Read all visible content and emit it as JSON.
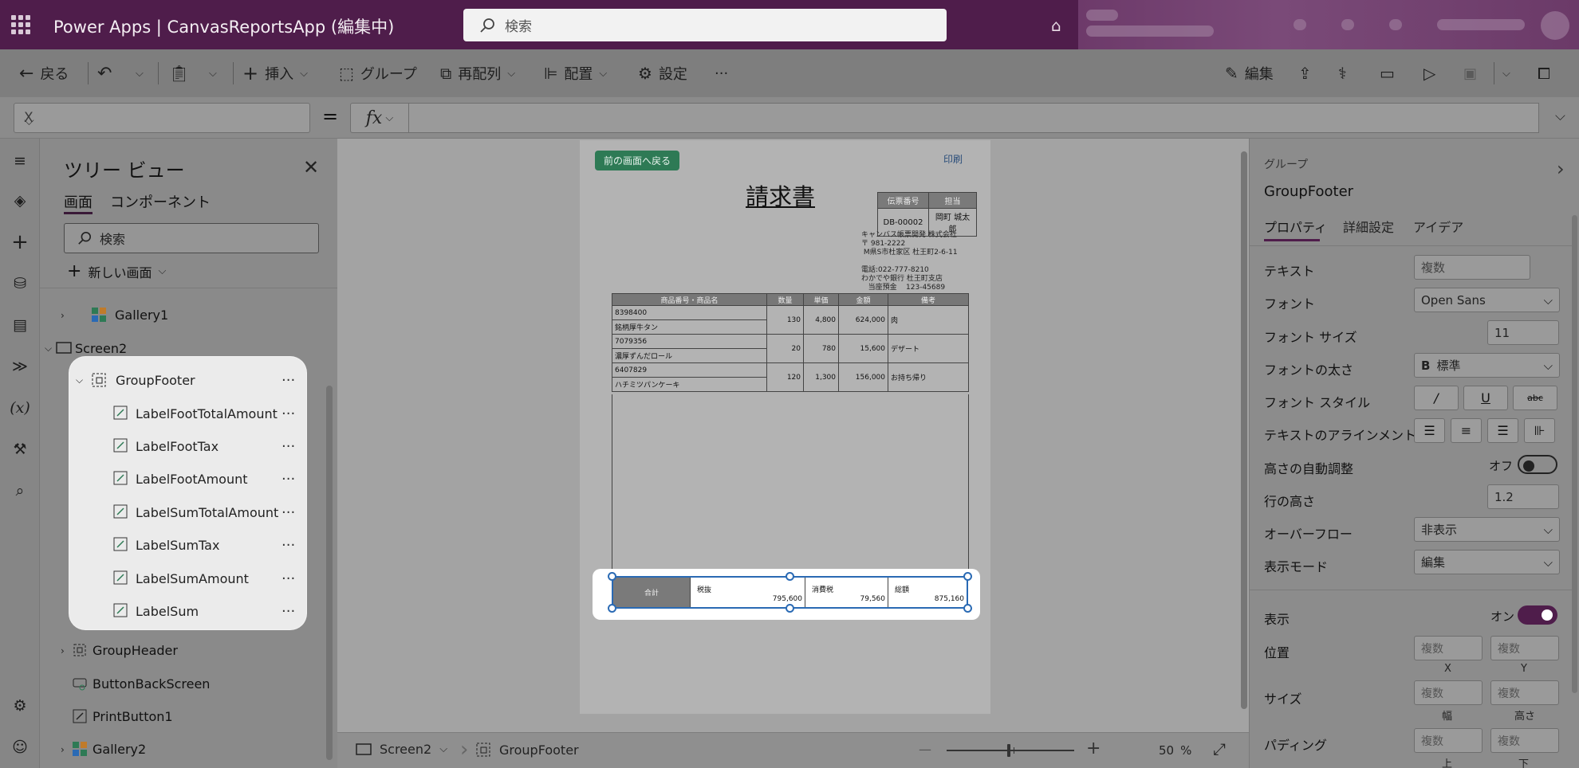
{
  "header": {
    "app_title": "Power Apps  |  CanvasReportsApp (編集中)",
    "search_placeholder": "検索"
  },
  "commandbar": {
    "back": "戻る",
    "insert": "挿入",
    "group": "グループ",
    "reorder": "再配列",
    "align": "配置",
    "settings": "設定",
    "more": "···",
    "edit": "編集"
  },
  "formulabar": {
    "property": "X",
    "equals": "=",
    "fx": "fx",
    "formula": ""
  },
  "tree": {
    "title": "ツリー ビュー",
    "tab_screens": "画面",
    "tab_components": "コンポーネント",
    "search_placeholder": "検索",
    "new_screen": "新しい画面",
    "items": [
      {
        "label": "Gallery1"
      },
      {
        "label": "Screen2"
      },
      {
        "label": "GroupFooter"
      },
      {
        "label": "LabelFootTotalAmount"
      },
      {
        "label": "LabelFootTax"
      },
      {
        "label": "LabelFootAmount"
      },
      {
        "label": "LabelSumTotalAmount"
      },
      {
        "label": "LabelSumTax"
      },
      {
        "label": "LabelSumAmount"
      },
      {
        "label": "LabelSum"
      },
      {
        "label": "GroupHeader"
      },
      {
        "label": "ButtonBackScreen"
      },
      {
        "label": "PrintButton1"
      },
      {
        "label": "Gallery2"
      }
    ],
    "dots": "···"
  },
  "canvas": {
    "back_button": "前の画面へ戻る",
    "print": "印刷",
    "title": "請求書",
    "slip": {
      "headers": [
        "伝票番号",
        "担当"
      ],
      "values": [
        "DB-00002",
        "岡町 城太郎"
      ]
    },
    "company": "キャンバス帳票開発 株式会社\n〒 981-2222\n M県S市杜家区 杜王町2-6-11\n\n電話:022-777-8210\nわかでや銀行 杜王町支店\n   当座預金    123-45689",
    "item_headers": [
      "商品番号・商品名",
      "数量",
      "単価",
      "金額",
      "備考"
    ],
    "items": [
      {
        "code": "8398400",
        "name": "銘柄厚牛タン",
        "qty": "130",
        "price": "4,800",
        "amount": "624,000",
        "note": "肉"
      },
      {
        "code": "7079356",
        "name": "濃厚ずんだロール",
        "qty": "20",
        "price": "780",
        "amount": "15,600",
        "note": "デザート"
      },
      {
        "code": "6407829",
        "name": "ハチミツパンケーキ",
        "qty": "120",
        "price": "1,300",
        "amount": "156,000",
        "note": "お持ち帰り"
      }
    ],
    "footer": {
      "sum_label": "合計",
      "tax_excl_label": "税抜",
      "tax_excl_value": "795,600",
      "tax_label": "消費税",
      "tax_value": "79,560",
      "total_label": "総額",
      "total_value": "875,160"
    }
  },
  "canvas_bar": {
    "screen": "Screen2",
    "group": "GroupFooter",
    "minus": "—",
    "plus": "+",
    "zoom": "50",
    "zoom_unit": "%"
  },
  "props": {
    "type": "グループ",
    "name": "GroupFooter",
    "tabs": [
      "プロパティ",
      "詳細設定",
      "アイデア"
    ],
    "text_label": "テキスト",
    "text_value": "複数",
    "font_label": "フォント",
    "font_value": "Open Sans",
    "font_size_label": "フォント サイズ",
    "font_size_value": "11",
    "font_weight_label": "フォントの太さ",
    "font_weight_value": "標準",
    "font_weight_glyph": "B",
    "font_style_label": "フォント スタイル",
    "italic": "/",
    "underline": "U",
    "strike": "abc",
    "text_align_label": "テキストのアラインメント",
    "auto_height_label": "高さの自動調整",
    "auto_height_value": "オフ",
    "line_height_label": "行の高さ",
    "line_height_value": "1.2",
    "overflow_label": "オーバーフロー",
    "overflow_value": "非表示",
    "display_mode_label": "表示モード",
    "display_mode_value": "編集",
    "visible_label": "表示",
    "visible_value": "オン",
    "position_label": "位置",
    "position_x": "複数",
    "position_y": "複数",
    "x_caption": "X",
    "y_caption": "Y",
    "size_label": "サイズ",
    "width_value": "複数",
    "height_value": "複数",
    "width_caption": "幅",
    "height_caption": "高さ",
    "padding_label": "パディング",
    "padding_top": "複数",
    "padding_bottom": "複数",
    "padding_top_caption": "上",
    "padding_bottom_caption": "下"
  },
  "colors": {
    "brand": "#4f1d4b",
    "selection": "#2a6ab4",
    "back_button": "#2e7a55"
  }
}
